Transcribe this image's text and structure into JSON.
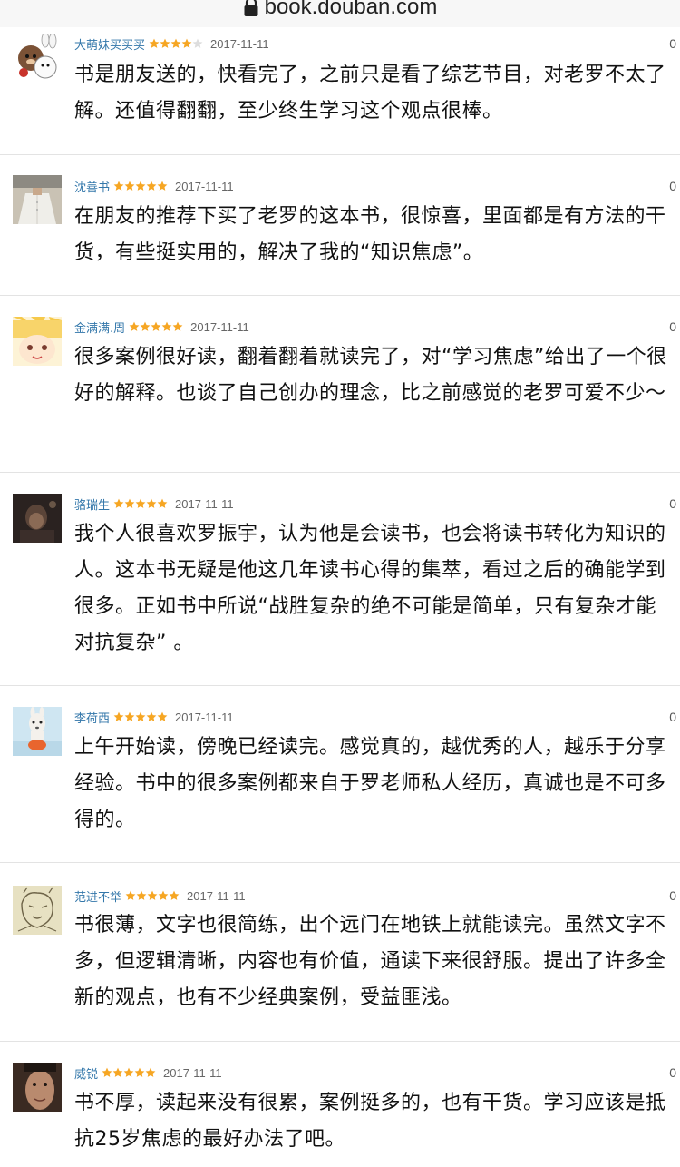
{
  "browser": {
    "url": "book.douban.com"
  },
  "reviews": [
    {
      "user": "大萌妹买买买",
      "rating": 4,
      "date": "2017-11-11",
      "votes": "0",
      "text": "书是朋友送的，快看完了，之前只是看了综艺节目，对老罗不太了解。还值得翻翻，至少终生学习这个观点很棒。"
    },
    {
      "user": "沈善书",
      "rating": 5,
      "date": "2017-11-11",
      "votes": "0",
      "text": "在朋友的推荐下买了老罗的这本书，很惊喜，里面都是有方法的干货，有些挺实用的，解决了我的“知识焦虑”。"
    },
    {
      "user": "金满满.周",
      "rating": 5,
      "date": "2017-11-11",
      "votes": "0",
      "text": "很多案例很好读，翻着翻着就读完了，对“学习焦虑”给出了一个很好的解释。也谈了自己创办的理念，比之前感觉的老罗可爱不少～"
    },
    {
      "user": "骆瑞生",
      "rating": 5,
      "date": "2017-11-11",
      "votes": "0",
      "text": "我个人很喜欢罗振宇，认为他是会读书，也会将读书转化为知识的人。这本书无疑是他这几年读书心得的集萃，看过之后的确能学到很多。正如书中所说“战胜复杂的绝不可能是简单，只有复杂才能对抗复杂” 。"
    },
    {
      "user": "李荷西",
      "rating": 5,
      "date": "2017-11-11",
      "votes": "0",
      "text": "上午开始读，傍晚已经读完。感觉真的，越优秀的人，越乐于分享经验。书中的很多案例都来自于罗老师私人经历，真诚也是不可多得的。"
    },
    {
      "user": "范进不举",
      "rating": 5,
      "date": "2017-11-11",
      "votes": "0",
      "text": "书很薄，文字也很简练，出个远门在地铁上就能读完。虽然文字不多，但逻辑清晰，内容也有价值，通读下来很舒服。提出了许多全新的观点，也有不少经典案例，受益匪浅。"
    },
    {
      "user": "威锐",
      "rating": 5,
      "date": "2017-11-11",
      "votes": "0",
      "text": "书不厚，读起来没有很累，案例挺多的，也有干货。学习应该是抵抗25岁焦虑的最好办法了吧。"
    }
  ],
  "colors": {
    "username": "#3377aa",
    "star_filled": "#f6a623",
    "star_empty": "#dddddd",
    "divider": "#e3e3e3"
  },
  "icons": {
    "lock": "lock-icon",
    "star": "star-icon",
    "avatar": "avatar-image"
  }
}
